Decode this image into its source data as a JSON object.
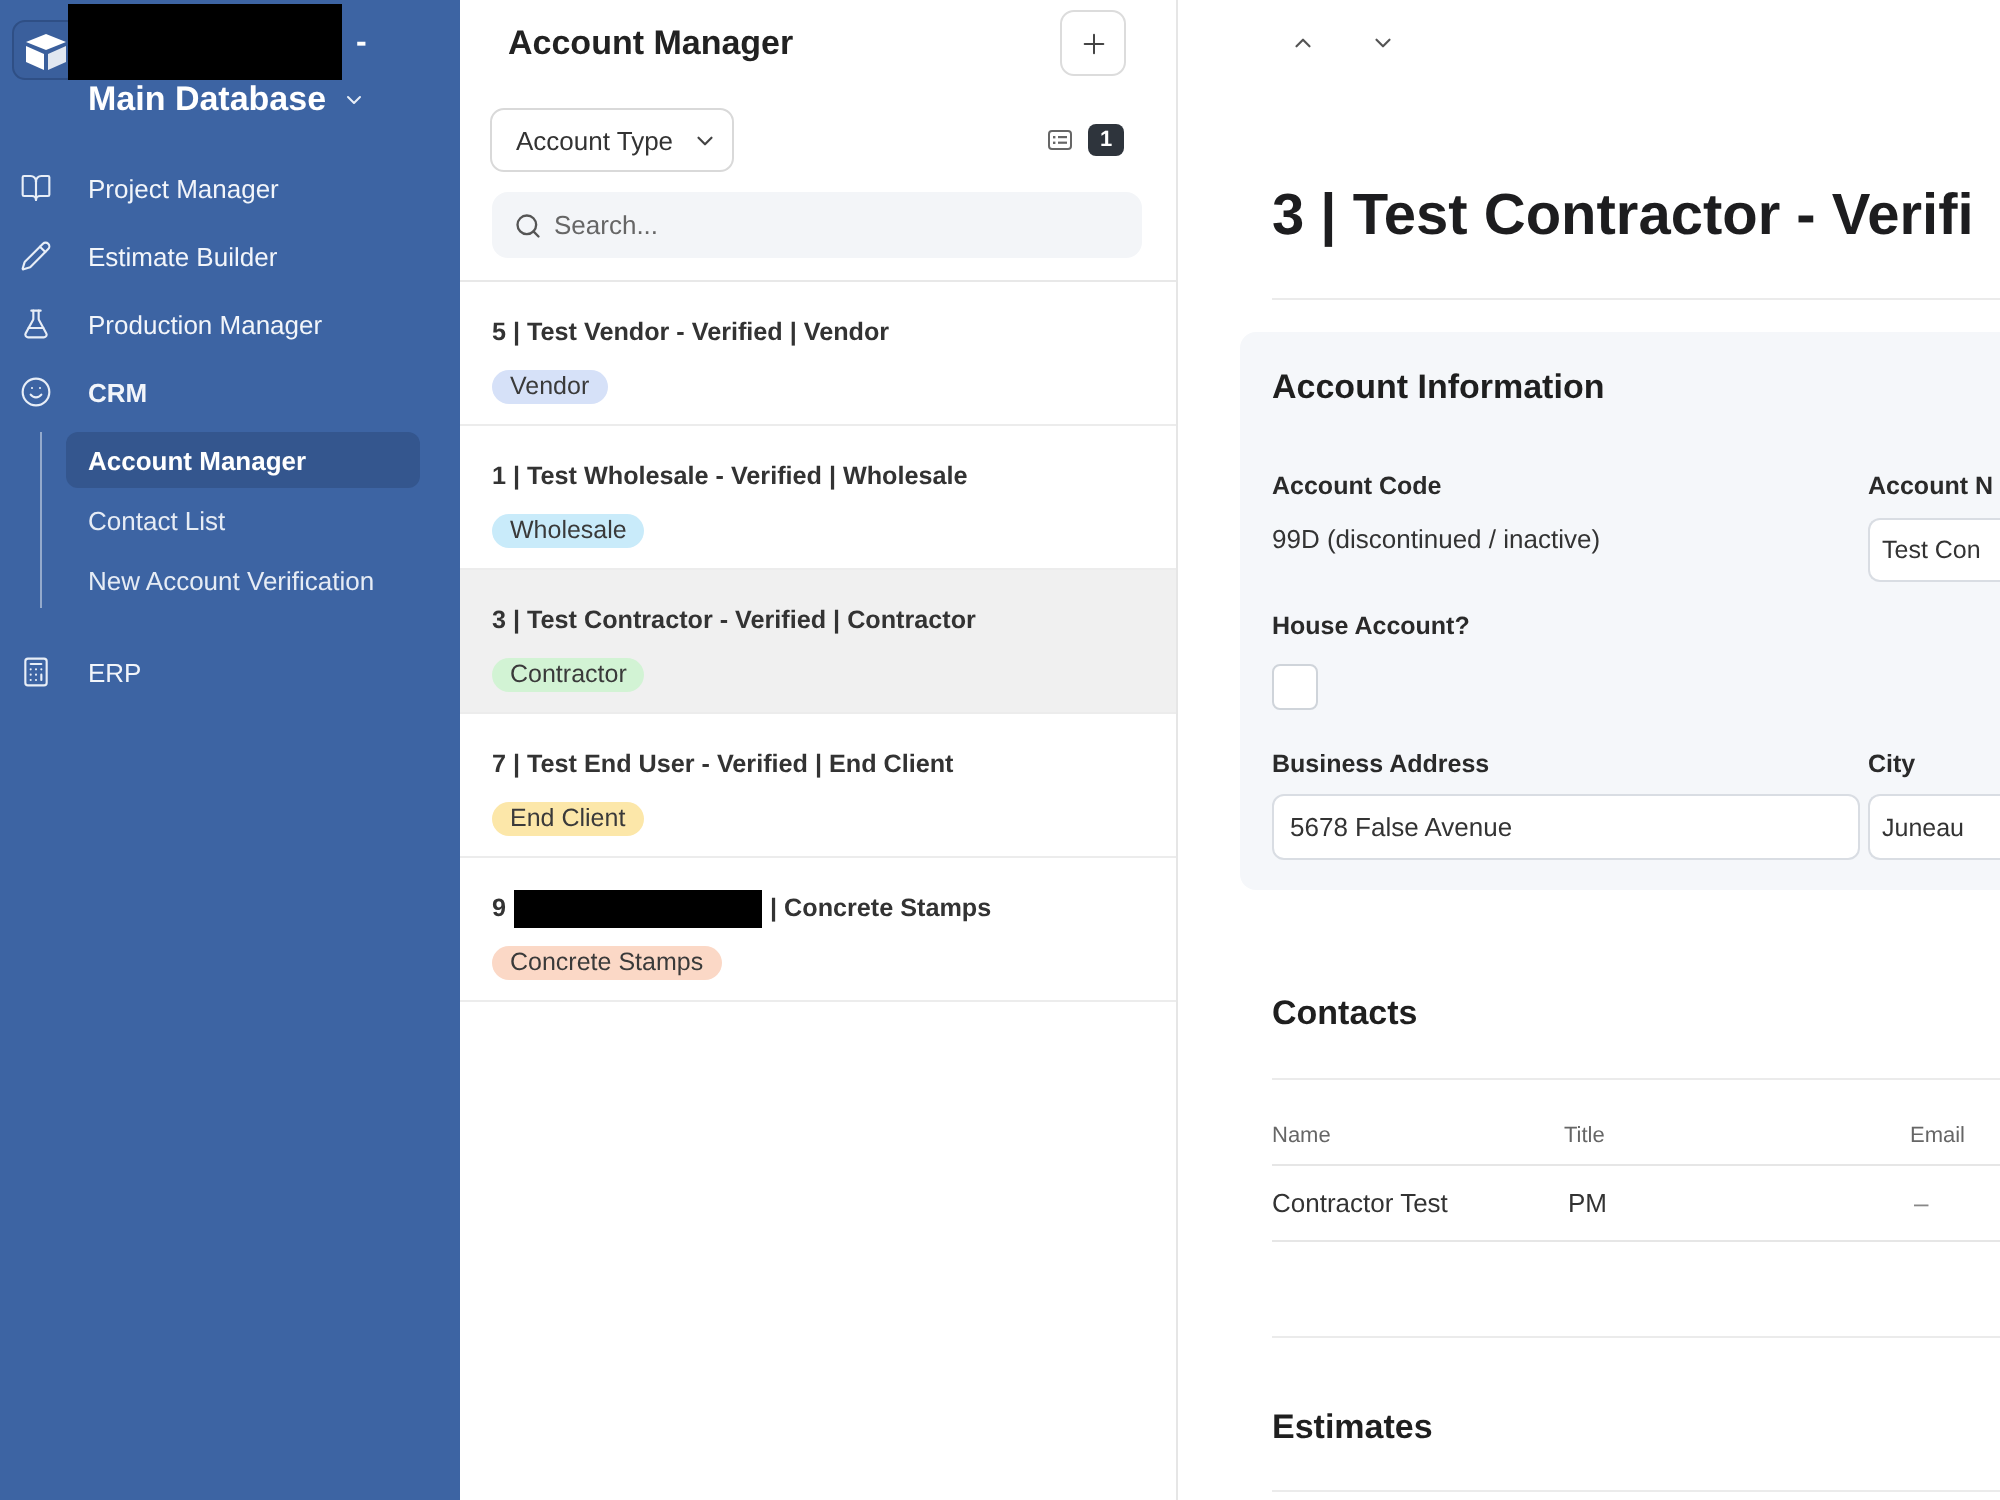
{
  "sidebar": {
    "brand": {
      "redacted": true,
      "suffix": "-",
      "workspace": "Main Database"
    },
    "items": [
      {
        "label": "Project Manager",
        "expanded": false
      },
      {
        "label": "Estimate Builder",
        "expanded": false
      },
      {
        "label": "Production Manager",
        "expanded": false
      },
      {
        "label": "CRM",
        "expanded": true,
        "children": [
          {
            "label": "Account Manager",
            "selected": true
          },
          {
            "label": "Contact List",
            "selected": false
          },
          {
            "label": "New Account Verification",
            "selected": false
          }
        ]
      },
      {
        "label": "ERP",
        "expanded": false
      }
    ]
  },
  "list": {
    "title": "Account Manager",
    "filter": {
      "label": "Account Type"
    },
    "filter_count": "1",
    "search": {
      "placeholder": "Search..."
    },
    "rows": [
      {
        "title": "5 | Test Vendor - Verified | Vendor",
        "redacted": false,
        "tag": "Vendor",
        "color": "#d6e1f8",
        "selected": false
      },
      {
        "title": "1 | Test Wholesale - Verified | Wholesale",
        "redacted": false,
        "tag": "Wholesale",
        "color": "#c9ebfa",
        "selected": false
      },
      {
        "title": "3 | Test Contractor - Verified | Contractor",
        "redacted": false,
        "tag": "Contractor",
        "color": "#d2f3d4",
        "selected": true
      },
      {
        "title": "7 | Test End User - Verified | End Client",
        "redacted": false,
        "tag": "End Client",
        "color": "#fce7a9",
        "selected": false
      },
      {
        "title": "9",
        "redacted": true,
        "title_after": "| Concrete Stamps",
        "tag": "Concrete Stamps",
        "color": "#fbd8c6",
        "selected": false
      }
    ]
  },
  "detail": {
    "title": "3 | Test Contractor - Verifi",
    "account_information": {
      "heading": "Account Information",
      "account_code": {
        "label": "Account Code",
        "value": "99D (discontinued / inactive)"
      },
      "account_name": {
        "label": "Account N",
        "value": "Test Con"
      },
      "house_account": {
        "label": "House Account?",
        "checked": false
      },
      "business_address": {
        "label": "Business Address",
        "value": "5678 False Avenue"
      },
      "city": {
        "label": "City",
        "value": "Juneau"
      }
    },
    "contacts": {
      "heading": "Contacts",
      "columns": [
        "Name",
        "Title",
        "Email"
      ],
      "rows": [
        [
          "Contractor Test",
          "PM",
          "–"
        ]
      ]
    },
    "estimates": {
      "heading": "Estimates"
    }
  }
}
